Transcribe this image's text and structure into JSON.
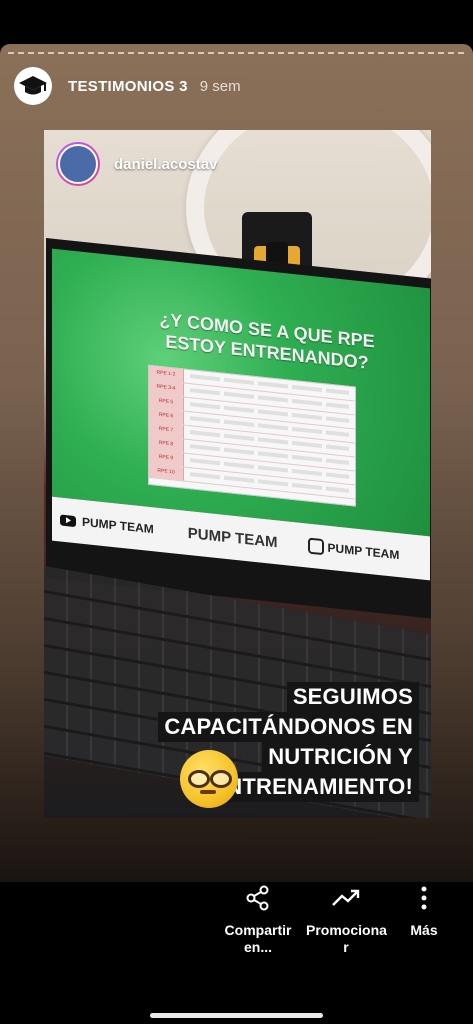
{
  "story": {
    "account_name": "TESTIMONIOS 3",
    "time_ago": "9 sem"
  },
  "post": {
    "username": "daniel.acostav",
    "screen_title": "¿Y COMO SE A QUE RPE ESTOY ENTRENANDO?",
    "rpe_rows": [
      "RPE 1-2",
      "RPE 3-4",
      "RPE 5",
      "RPE 6",
      "RPE 7",
      "RPE 8",
      "RPE 9",
      "RPE 10"
    ],
    "banner_left": "PUMP TEAM",
    "banner_center": "PUMP TEAM",
    "banner_right": "PUMP TEAM",
    "caption_lines": [
      "SEGUIMOS",
      "CAPACITÁNDONOS EN",
      "NUTRICIÓN Y",
      "ENTRENAMIENTO!"
    ]
  },
  "actions": {
    "share_label": "Compartir en...",
    "promote_label": "Promociona r",
    "more_label": "Más"
  }
}
